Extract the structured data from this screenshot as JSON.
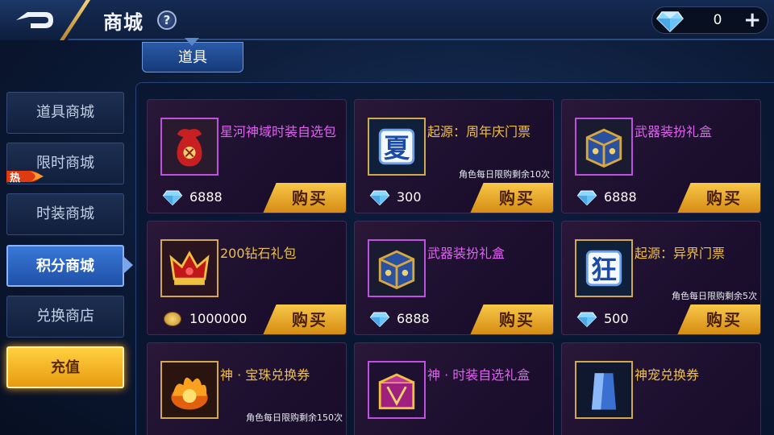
{
  "header": {
    "title": "商城",
    "help_label": "?",
    "currency_value": "0",
    "plus_label": "+"
  },
  "tab": {
    "label": "道具"
  },
  "sidebar": {
    "items": [
      {
        "label": "道具商城"
      },
      {
        "label": "限时商城"
      },
      {
        "label": "时装商城"
      },
      {
        "label": "积分商城"
      },
      {
        "label": "兑换商店"
      },
      {
        "label": "充值"
      }
    ],
    "hot_badge": "热",
    "active_index": 3
  },
  "buy_label": "购买",
  "items": [
    {
      "name": "星河神域时装自选包",
      "name_color": "purple",
      "price": "6888",
      "currency": "diamond",
      "limit": "",
      "icon": "red-pouch-icon"
    },
    {
      "name": "起源：周年庆门票",
      "name_color": "gold",
      "price": "300",
      "currency": "diamond",
      "limit": "角色每日限购剩余10次",
      "icon": "xia-ticket-icon"
    },
    {
      "name": "武器装扮礼盒",
      "name_color": "purple",
      "price": "6888",
      "currency": "diamond",
      "limit": "",
      "icon": "gift-box-icon"
    },
    {
      "name": "200钻石礼包",
      "name_color": "gold",
      "price": "1000000",
      "currency": "coin",
      "limit": "",
      "icon": "red-crown-icon"
    },
    {
      "name": "武器装扮礼盒",
      "name_color": "purple",
      "price": "6888",
      "currency": "diamond",
      "limit": "",
      "icon": "gift-box-icon"
    },
    {
      "name": "起源：异界门票",
      "name_color": "gold",
      "price": "500",
      "currency": "diamond",
      "limit": "角色每日限购剩余5次",
      "icon": "kuang-ticket-icon"
    },
    {
      "name": "神 · 宝珠兑换券",
      "name_color": "gold",
      "price": "",
      "currency": "",
      "limit": "角色每日限购剩余150次",
      "icon": "fire-orb-icon"
    },
    {
      "name": "神 · 时装自选礼盒",
      "name_color": "purple",
      "price": "",
      "currency": "",
      "limit": "",
      "icon": "costume-box-icon"
    },
    {
      "name": "神宠兑换券",
      "name_color": "gold",
      "price": "",
      "currency": "",
      "limit": "",
      "icon": "blue-crystal-icon"
    }
  ],
  "colors": {
    "gold_name": "#f0c040",
    "purple_name": "#e060f0",
    "buy_button": "#f0b030",
    "active_tab": "#2a66c8"
  }
}
